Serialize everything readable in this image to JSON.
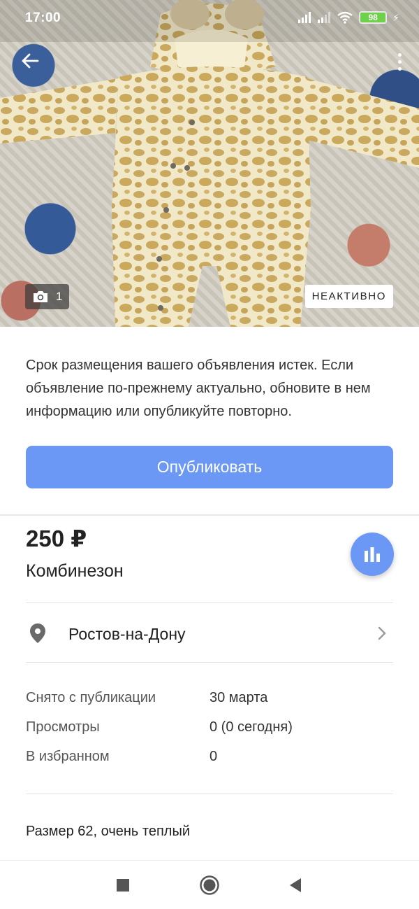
{
  "status_bar": {
    "time": "17:00",
    "battery": "98"
  },
  "photo": {
    "count": "1",
    "status_badge": "НЕАКТИВНО"
  },
  "notice": {
    "text": "Срок размещения вашего объявления истек. Если объявление по-прежнему актуально, обновите в нем информацию или опубликуйте повторно."
  },
  "publish_button": {
    "label": "Опубликовать"
  },
  "listing": {
    "price": "250 ₽",
    "title": "Комбинезон",
    "location": "Ростов-на-Дону",
    "details": [
      {
        "key": "Снято с публикации",
        "value": "30 марта"
      },
      {
        "key": "Просмотры",
        "value": "0 (0 сегодня)"
      },
      {
        "key": "В избранном",
        "value": "0"
      }
    ],
    "description": "Размер 62, очень теплый"
  },
  "colors": {
    "accent": "#6b97f5",
    "badge_bg": "#ffffff",
    "battery": "#6fd04b"
  },
  "icons": {
    "back": "arrow-left-icon",
    "more": "more-vert-icon",
    "camera": "camera-icon",
    "stats": "bar-chart-icon",
    "location": "map-pin-icon",
    "chevron": "chevron-right-icon",
    "nav_recent": "square-icon",
    "nav_home": "circle-icon",
    "nav_back": "triangle-back-icon"
  }
}
